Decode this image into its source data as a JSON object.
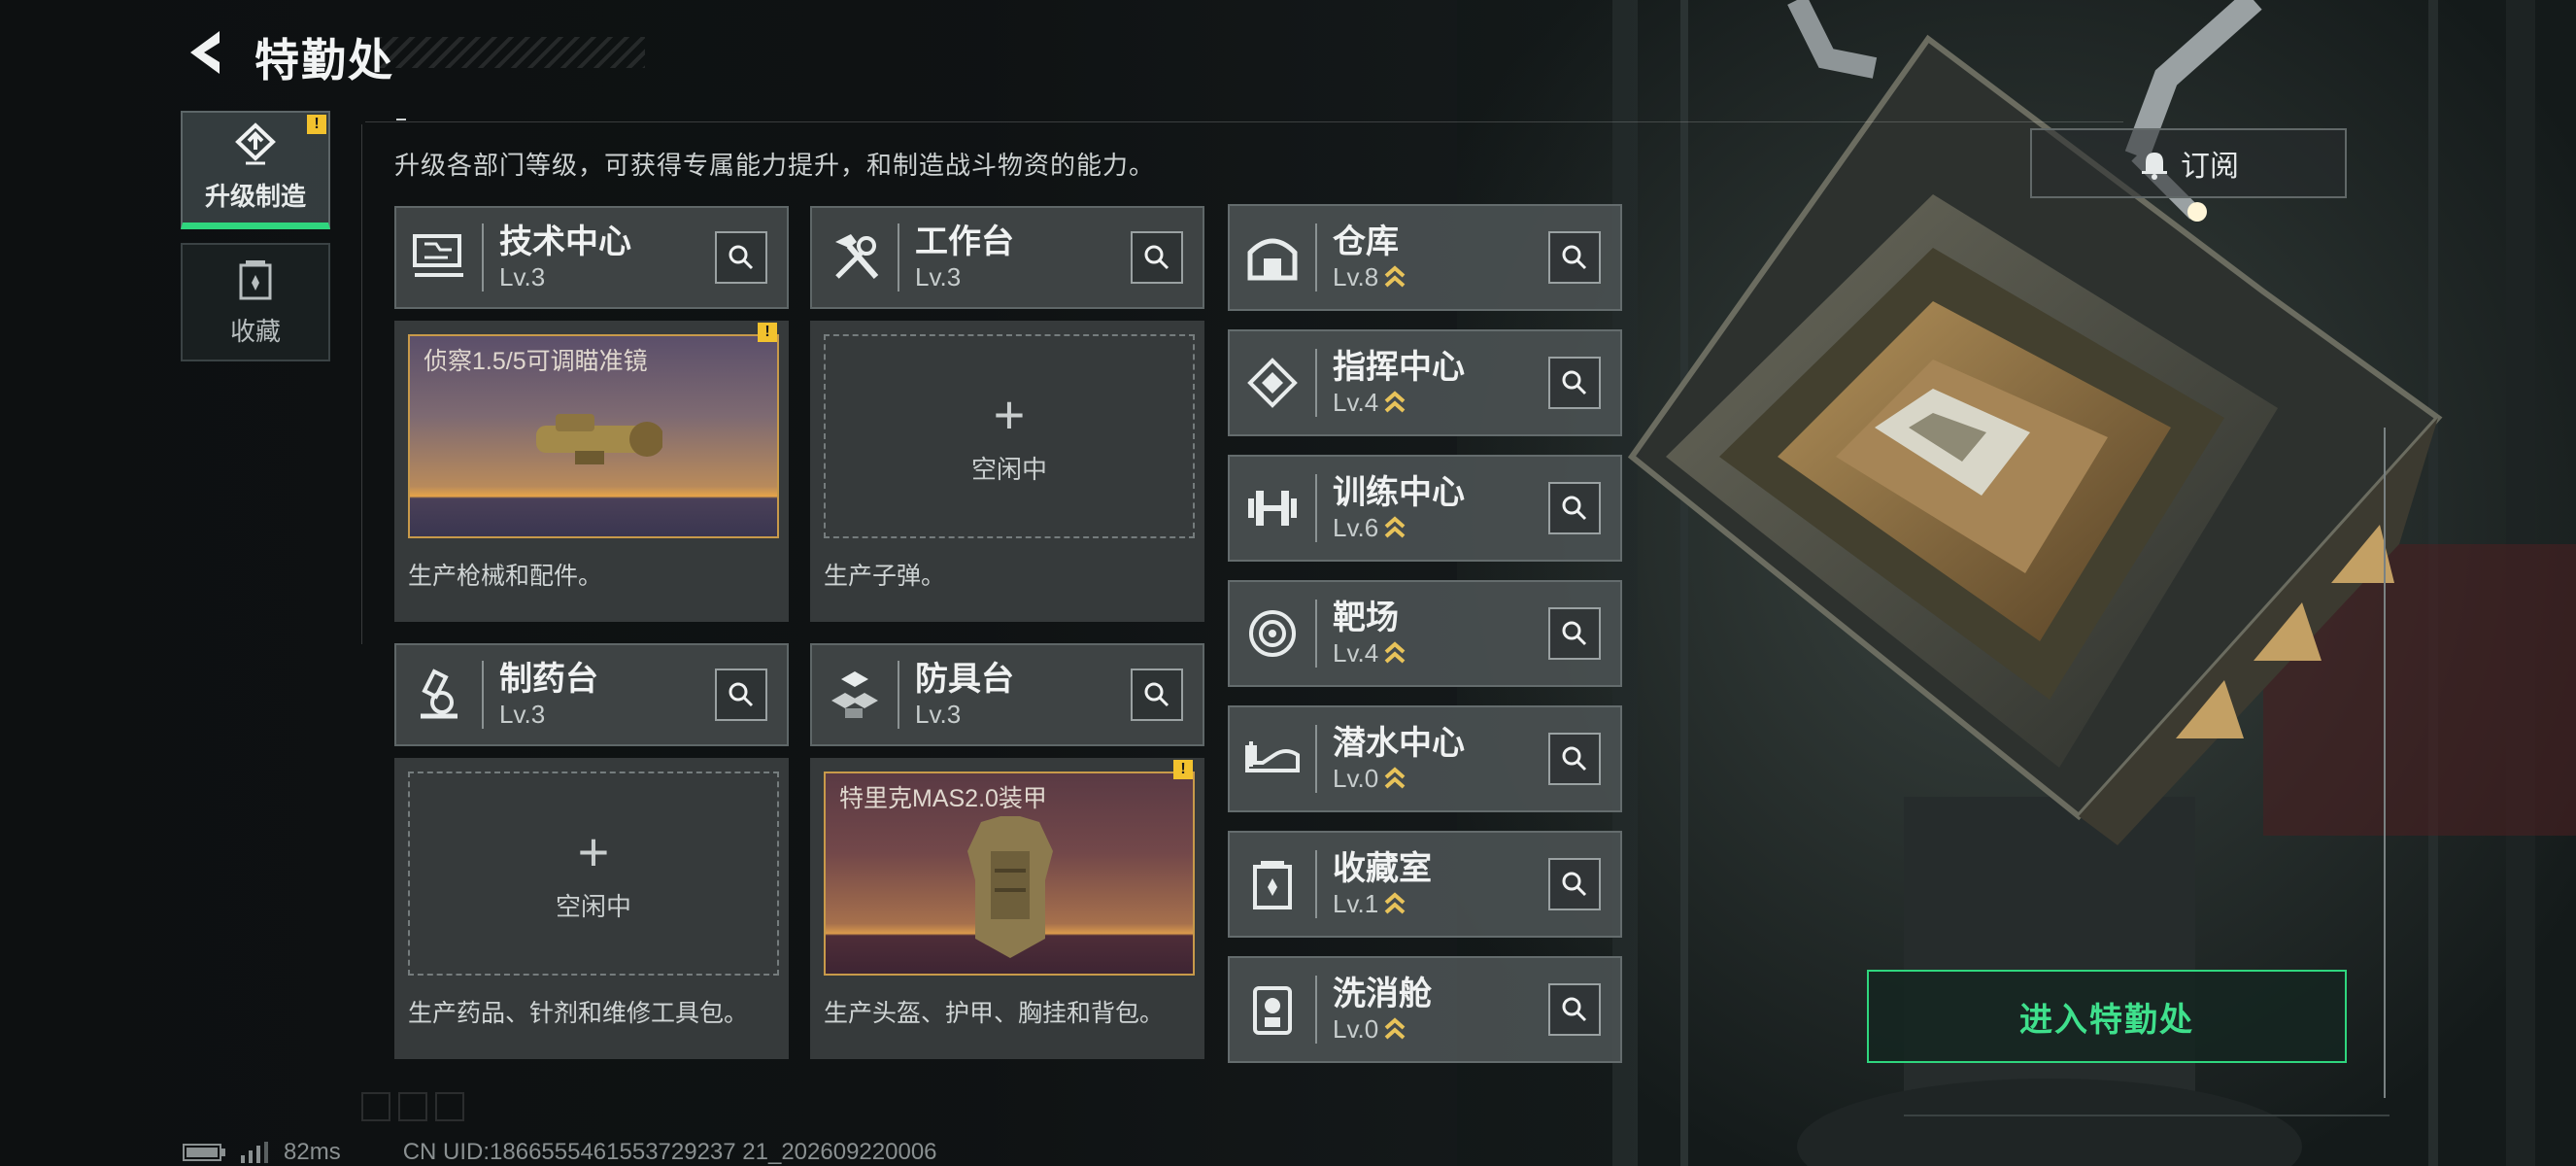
{
  "header": {
    "title": "特勤处",
    "description": "升级各部门等级，可获得专属能力提升，和制造战斗物资的能力。"
  },
  "tabs": [
    {
      "label": "升级制造",
      "active": true,
      "badge": "!",
      "icon": "upgrade-icon"
    },
    {
      "label": "收藏",
      "active": false,
      "icon": "collection-icon"
    }
  ],
  "workshops": {
    "tech_center": {
      "name": "技术中心",
      "level": "Lv.3",
      "icon": "circuit-board-icon",
      "producing": "侦察1.5/5可调瞄准镜",
      "badge": "!",
      "desc": "生产枪械和配件。"
    },
    "workbench": {
      "name": "工作台",
      "level": "Lv.3",
      "icon": "hammer-wrench-icon",
      "idle_plus": "+",
      "idle_label": "空闲中",
      "desc": "生产子弹。"
    },
    "pharmacy": {
      "name": "制药台",
      "level": "Lv.3",
      "icon": "microscope-icon",
      "idle_plus": "+",
      "idle_label": "空闲中",
      "desc": "生产药品、针剂和维修工具包。"
    },
    "armor_bench": {
      "name": "防具台",
      "level": "Lv.3",
      "icon": "cubes-icon",
      "producing": "特里克MAS2.0装甲",
      "badge": "!",
      "desc": "生产头盔、护甲、胸挂和背包。"
    }
  },
  "facilities": [
    {
      "name": "仓库",
      "level": "Lv.8",
      "icon": "warehouse-icon"
    },
    {
      "name": "指挥中心",
      "level": "Lv.4",
      "icon": "command-diamond-icon"
    },
    {
      "name": "训练中心",
      "level": "Lv.6",
      "icon": "dumbbell-icon"
    },
    {
      "name": "靶场",
      "level": "Lv.4",
      "icon": "target-icon"
    },
    {
      "name": "潜水中心",
      "level": "Lv.0",
      "icon": "diving-mask-icon"
    },
    {
      "name": "收藏室",
      "level": "Lv.1",
      "icon": "collection-room-icon"
    },
    {
      "name": "洗消舱",
      "level": "Lv.0",
      "icon": "decon-icon"
    }
  ],
  "subscribe": {
    "label": "订阅",
    "icon": "bell-icon"
  },
  "enter": {
    "label": "进入特勤处"
  },
  "footer": {
    "ping": "82ms",
    "uid": "CN UID:1866555461553729237 21_202609220006"
  },
  "colors": {
    "accent_green": "#2fd67e",
    "alert_yellow": "#f2c22e",
    "level_chevron": "#e8c35a",
    "product_border": "#c89a4a"
  }
}
